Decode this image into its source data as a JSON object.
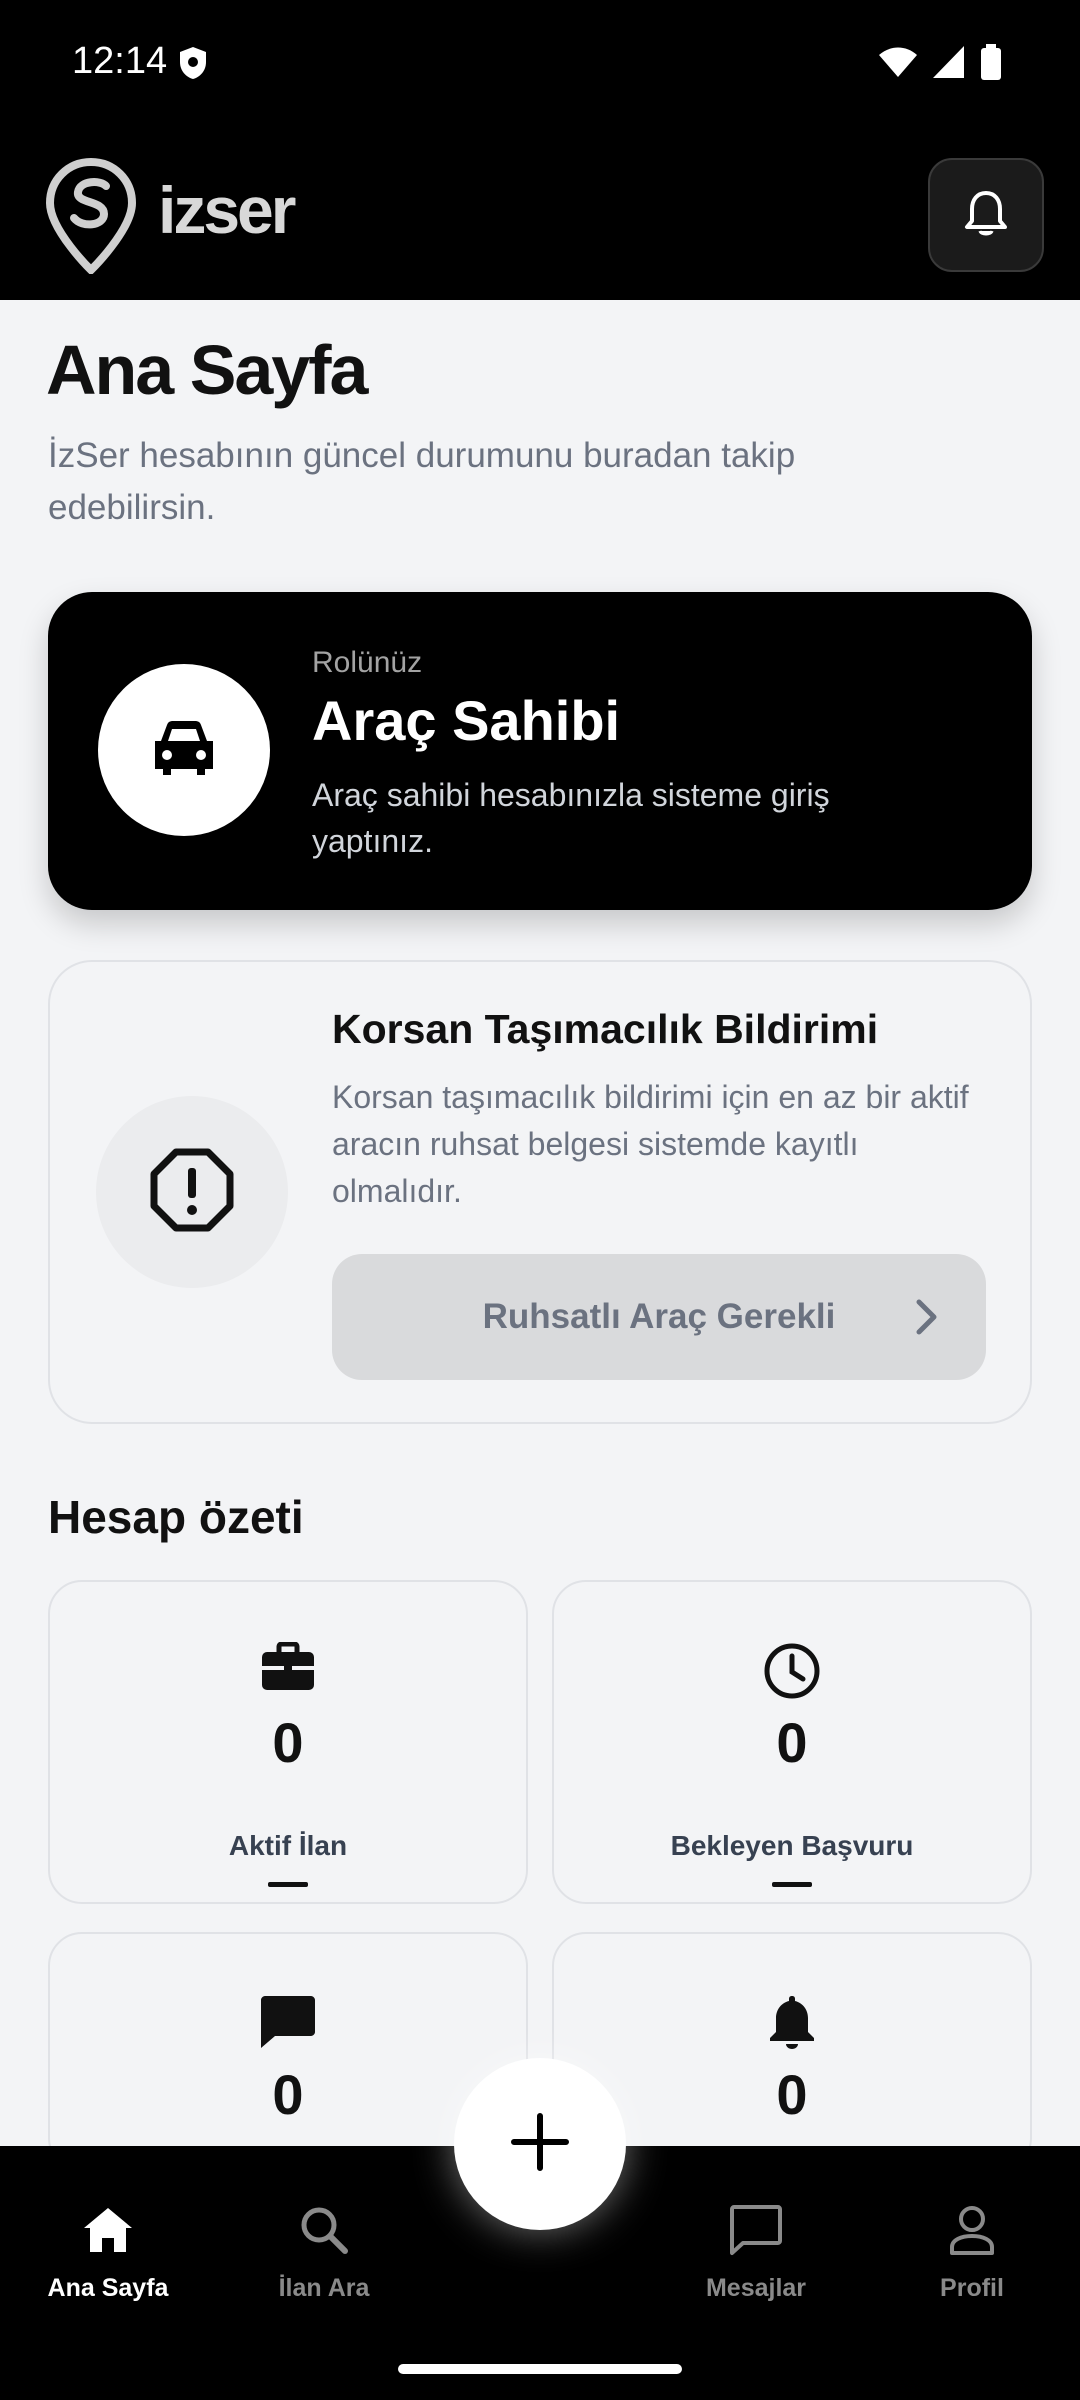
{
  "status": {
    "time": "12:14",
    "icons": [
      "shield-icon",
      "wifi-icon",
      "signal-icon",
      "battery-icon"
    ]
  },
  "header": {
    "logo_text": "izser",
    "bell_icon": "bell-icon"
  },
  "page": {
    "title": "Ana Sayfa",
    "subtitle": "İzSer hesabının güncel durumunu buradan takip edebilirsin."
  },
  "role_card": {
    "caption": "Rolünüz",
    "title": "Araç Sahibi",
    "description": "Araç sahibi hesabınızla sisteme giriş yaptınız.",
    "icon": "car-icon"
  },
  "report_card": {
    "title": "Korsan Taşımacılık Bildirimi",
    "description": "Korsan taşımacılık bildirimi için en az bir aktif aracın ruhsat belgesi sistemde kayıtlı olmalıdır.",
    "button_label": "Ruhsatlı Araç Gerekli",
    "icon": "warning-octagon-icon"
  },
  "summary": {
    "title": "Hesap özeti",
    "cards": [
      {
        "icon": "briefcase-icon",
        "value": "0",
        "label": "Aktif İlan"
      },
      {
        "icon": "clock-icon",
        "value": "0",
        "label": "Bekleyen Başvuru"
      },
      {
        "icon": "chat-icon",
        "value": "0",
        "label": ""
      },
      {
        "icon": "bell-icon",
        "value": "0",
        "label": ""
      }
    ]
  },
  "bottom_nav": {
    "items": [
      {
        "label": "Ana Sayfa",
        "icon": "home-icon",
        "active": true
      },
      {
        "label": "İlan Ara",
        "icon": "search-icon",
        "active": false
      },
      {
        "label": "Mesajlar",
        "icon": "message-icon",
        "active": false
      },
      {
        "label": "Profil",
        "icon": "user-icon",
        "active": false
      }
    ],
    "fab_icon": "plus-icon"
  },
  "colors": {
    "background": "#f3f4f6",
    "dark": "#000000",
    "muted_text": "#6b7280",
    "disabled_button": "#d9dadc"
  }
}
